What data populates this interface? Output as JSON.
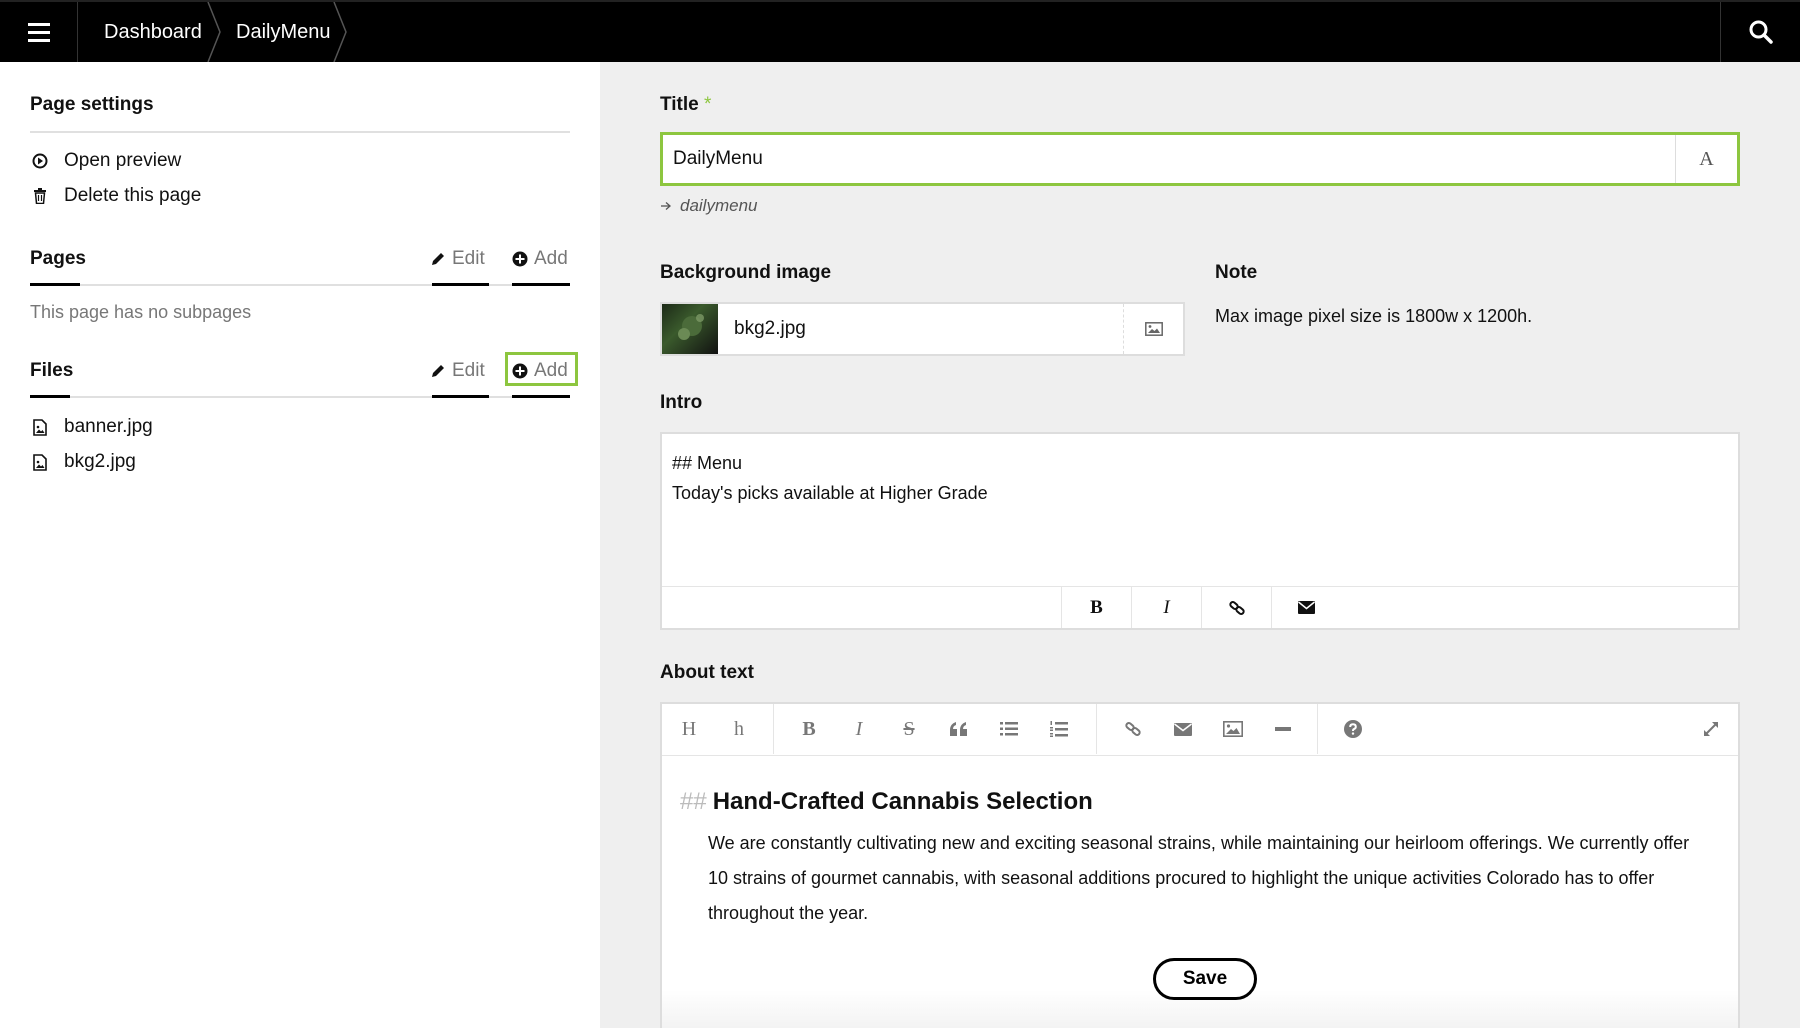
{
  "topbar": {
    "breadcrumbs": [
      "Dashboard",
      "DailyMenu"
    ]
  },
  "sidebar": {
    "page_settings": {
      "heading": "Page settings",
      "links": [
        {
          "label": "Open preview",
          "icon": "preview-icon"
        },
        {
          "label": "Delete this page",
          "icon": "trash-icon"
        }
      ]
    },
    "pages": {
      "heading": "Pages",
      "edit_label": "Edit",
      "add_label": "Add",
      "empty_text": "This page has no subpages"
    },
    "files": {
      "heading": "Files",
      "edit_label": "Edit",
      "add_label": "Add",
      "items": [
        {
          "name": "banner.jpg",
          "icon": "image-file-icon"
        },
        {
          "name": "bkg2.jpg",
          "icon": "image-file-icon"
        }
      ]
    }
  },
  "form": {
    "title": {
      "label": "Title",
      "required_mark": "*",
      "value": "DailyMenu",
      "slug": "dailymenu"
    },
    "background_image": {
      "label": "Background image",
      "filename": "bkg2.jpg"
    },
    "note": {
      "label": "Note",
      "text": "Max image pixel size is 1800w x 1200h."
    },
    "intro": {
      "label": "Intro",
      "line1": "## Menu",
      "line2": "Today's picks available at Higher Grade"
    },
    "about": {
      "label": "About text",
      "heading_marker": "##",
      "heading": "Hand-Crafted Cannabis Selection",
      "paragraph": "We are constantly cultivating new and exciting seasonal strains, while maintaining our heirloom offerings. We currently offer 10 strains of gourmet cannabis, with seasonal additions procured to highlight the unique activities Colorado has to offer throughout the year."
    },
    "save_label": "Save"
  },
  "colors": {
    "accent": "#8dc63f",
    "topbar": "#000000",
    "main_bg": "#efefef"
  }
}
